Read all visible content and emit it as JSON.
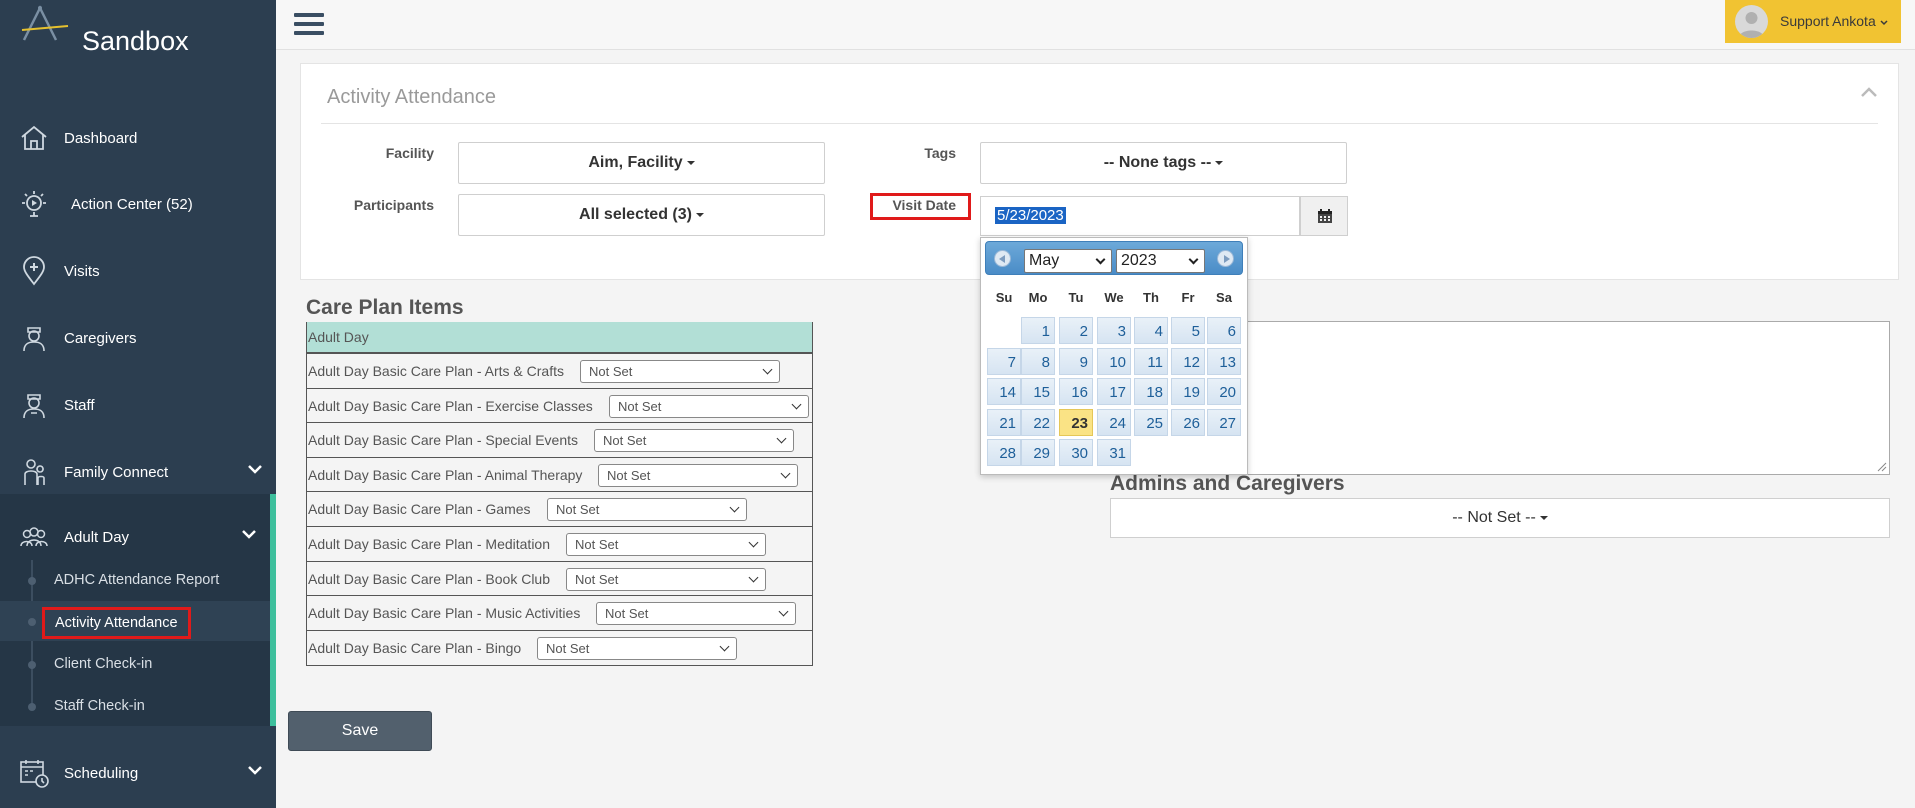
{
  "app": {
    "brand": "Sandbox"
  },
  "sidebar": {
    "items": [
      {
        "label": "Dashboard",
        "icon": "home-icon"
      },
      {
        "label": "Action Center (52)",
        "icon": "action-center-icon"
      },
      {
        "label": "Visits",
        "icon": "map-pin-icon"
      },
      {
        "label": "Caregivers",
        "icon": "caregiver-icon"
      },
      {
        "label": "Staff",
        "icon": "staff-icon"
      },
      {
        "label": "Family Connect",
        "icon": "family-icon"
      },
      {
        "label": "Adult Day",
        "icon": "group-icon"
      },
      {
        "label": "Scheduling",
        "icon": "calendar-clock-icon"
      }
    ],
    "adult_day_sub": [
      "ADHC Attendance Report",
      "Activity Attendance",
      "Client Check-in",
      "Staff Check-in"
    ]
  },
  "topbar": {
    "user": "Support Ankota"
  },
  "panel": {
    "title": "Activity Attendance",
    "facility_label": "Facility",
    "facility_value": "Aim, Facility",
    "tags_label": "Tags",
    "tags_value": "-- None tags --",
    "participants_label": "Participants",
    "participants_value": "All selected (3)",
    "visit_date_label": "Visit Date",
    "visit_date_value": "5/23/2023"
  },
  "care_plan": {
    "title": "Care Plan Items",
    "group": "Adult Day",
    "rows": [
      {
        "label": "Adult Day Basic Care Plan - Arts & Crafts",
        "value": "Not Set"
      },
      {
        "label": "Adult Day Basic Care Plan - Exercise Classes",
        "value": "Not Set"
      },
      {
        "label": "Adult Day Basic Care Plan - Special Events",
        "value": "Not Set"
      },
      {
        "label": "Adult Day Basic Care Plan - Animal Therapy",
        "value": "Not Set"
      },
      {
        "label": "Adult Day Basic Care Plan - Games",
        "value": "Not Set"
      },
      {
        "label": "Adult Day Basic Care Plan - Meditation",
        "value": "Not Set"
      },
      {
        "label": "Adult Day Basic Care Plan - Book Club",
        "value": "Not Set"
      },
      {
        "label": "Adult Day Basic Care Plan - Music Activities",
        "value": "Not Set"
      },
      {
        "label": "Adult Day Basic Care Plan - Bingo",
        "value": "Not Set"
      }
    ]
  },
  "admins": {
    "title": "Admins and Caregivers",
    "value": "-- Not Set --"
  },
  "save_label": "Save",
  "datepicker": {
    "month": "May",
    "year": "2023",
    "dow": [
      "Su",
      "Mo",
      "Tu",
      "We",
      "Th",
      "Fr",
      "Sa"
    ],
    "first_weekday": 1,
    "days_in_month": 31,
    "selected_day": 23
  },
  "colors": {
    "sidebar": "#2c3e50",
    "accent": "#3dbf9c",
    "user_button": "#f1c332",
    "highlight_box": "#e01a1a",
    "selected_day": "#fae385"
  }
}
